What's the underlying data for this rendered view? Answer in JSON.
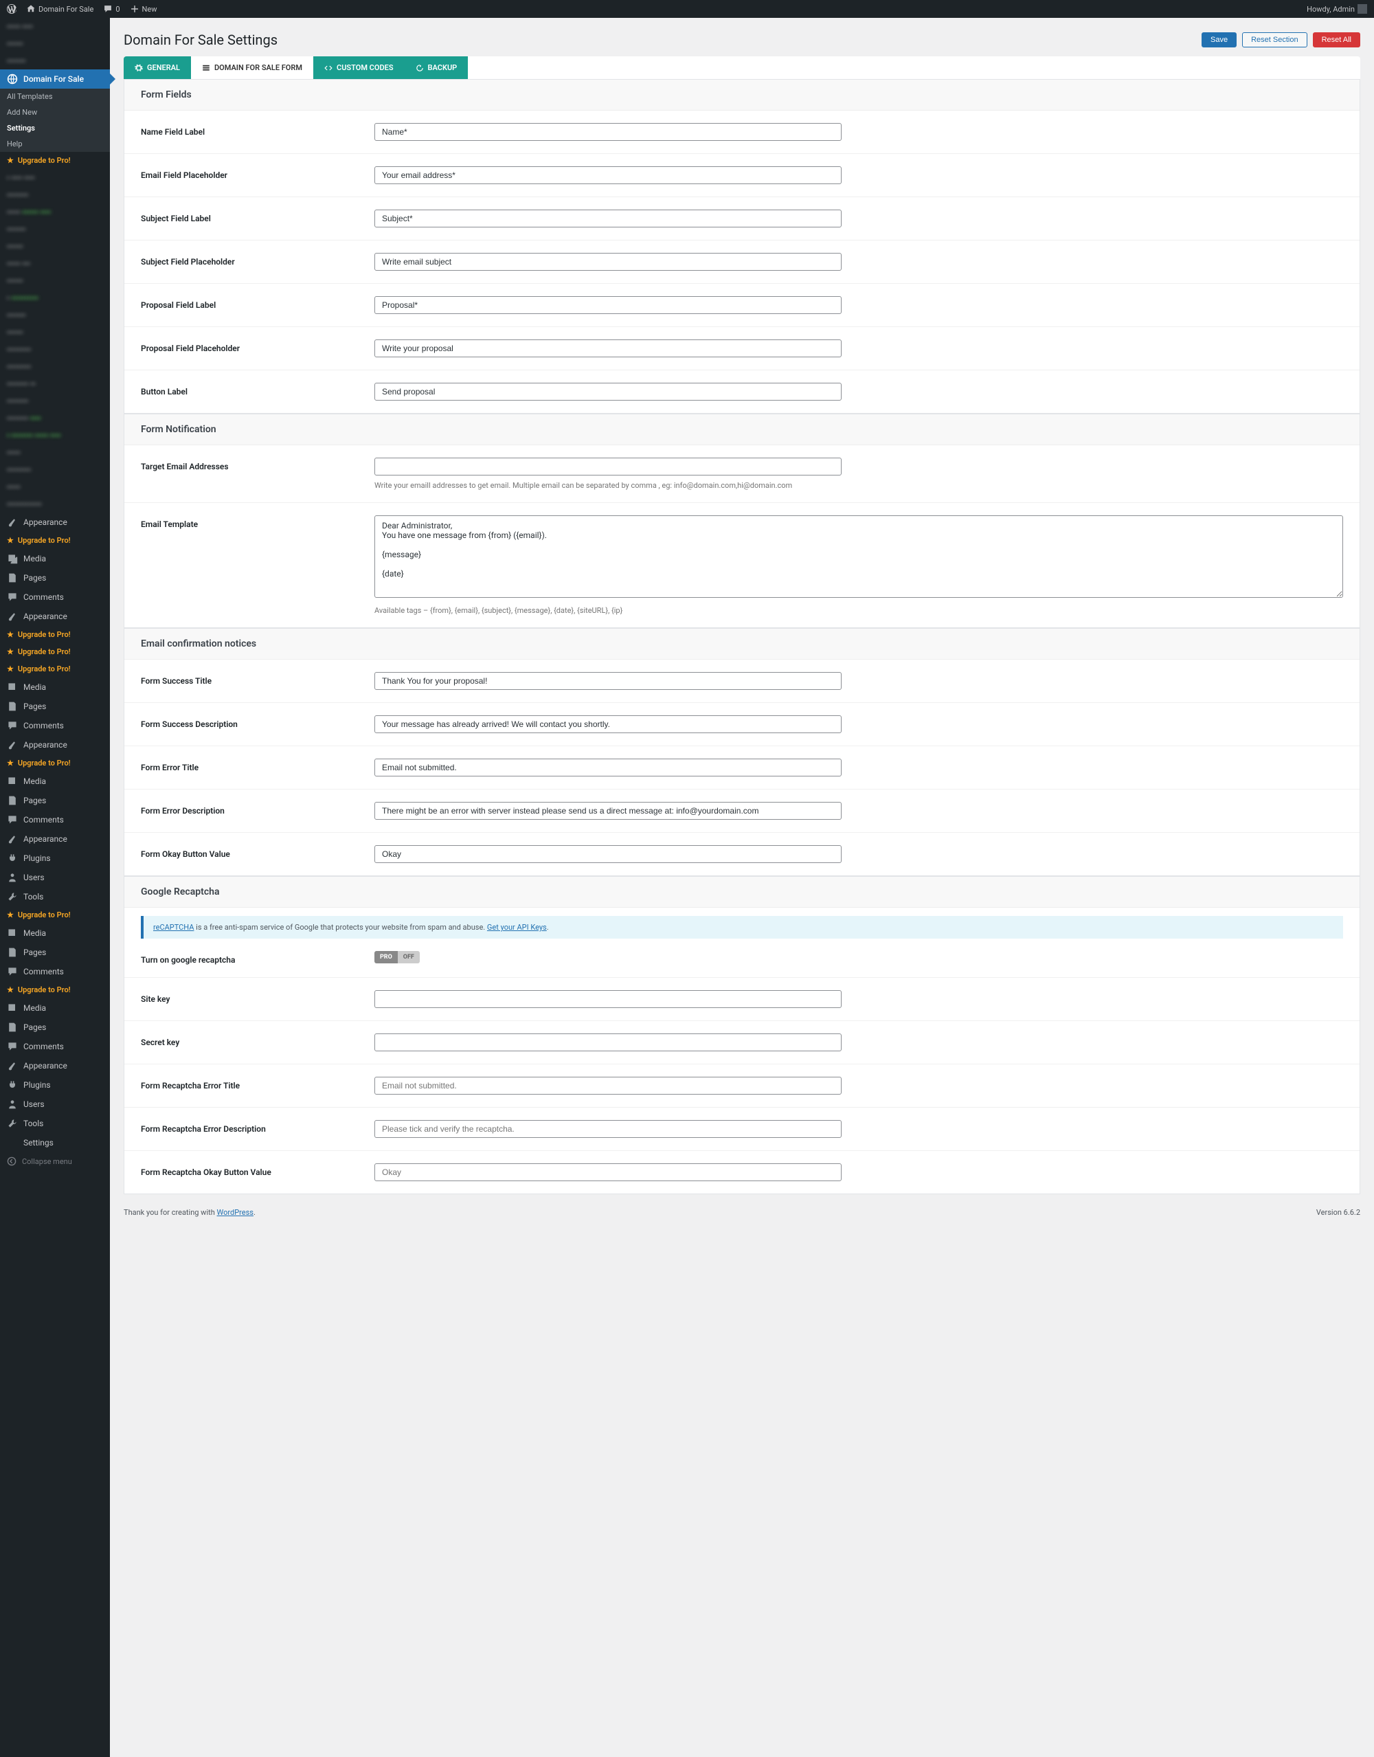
{
  "adminBar": {
    "siteName": "Domain For Sale",
    "comments": "0",
    "newLabel": "New",
    "howdy": "Howdy, Admin"
  },
  "sidebar": {
    "currentPlugin": "Domain For Sale",
    "sub": {
      "allTemplates": "All Templates",
      "addNew": "Add New",
      "settings": "Settings",
      "help": "Help"
    },
    "upgrade": "Upgrade to Pro!",
    "menu": {
      "media": "Media",
      "pages": "Pages",
      "comments": "Comments",
      "appearance": "Appearance",
      "plugins": "Plugins",
      "users": "Users",
      "tools": "Tools",
      "settings": "Settings",
      "collapse": "Collapse menu"
    }
  },
  "page": {
    "title": "Domain For Sale Settings",
    "save": "Save",
    "resetSection": "Reset Section",
    "resetAll": "Reset All"
  },
  "tabs": {
    "general": "GENERAL",
    "form": "DOMAIN FOR SALE FORM",
    "custom": "CUSTOM CODES",
    "backup": "BACKUP"
  },
  "sections": {
    "formFields": {
      "title": "Form Fields",
      "nameLabel": "Name Field Label",
      "nameValue": "Name*",
      "emailPhLabel": "Email Field Placeholder",
      "emailPhValue": "Your email address*",
      "subjLabel": "Subject Field Label",
      "subjValue": "Subject*",
      "subjPhLabel": "Subject Field Placeholder",
      "subjPhValue": "Write email subject",
      "propLabel": "Proposal Field Label",
      "propValue": "Proposal*",
      "propPhLabel": "Proposal Field Placeholder",
      "propPhValue": "Write your proposal",
      "btnLabel": "Button Label",
      "btnValue": "Send proposal"
    },
    "notification": {
      "title": "Form Notification",
      "targetLabel": "Target Email Addresses",
      "targetDesc": "Write your emaill addresses to get email. Multiple email can be separated by comma , eg: info@domain.com,hi@domain.com",
      "templateLabel": "Email Template",
      "templateValue": "Dear Administrator,\nYou have one message from {from} ({email}).\n\n{message}\n\n{date}",
      "templateDesc": "Available tags – {from}, {email}, {subject}, {message}, {date}, {siteURL}, {ip}"
    },
    "confirmation": {
      "title": "Email confirmation notices",
      "successTitleLabel": "Form Success Title",
      "successTitleValue": "Thank You for your proposal!",
      "successDescLabel": "Form Success Description",
      "successDescValue": "Your message has already arrived! We will contact you shortly.",
      "errorTitleLabel": "Form Error Title",
      "errorTitleValue": "Email not submitted.",
      "errorDescLabel": "Form Error Description",
      "errorDescValue": "There might be an error with server instead please send us a direct message at: info@yourdomain.com",
      "okayLabel": "Form Okay Button Value",
      "okayValue": "Okay"
    },
    "recaptcha": {
      "title": "Google Recaptcha",
      "infoLink1": "reCAPTCHA",
      "infoText": " is a free anti-spam service of Google that protects your website from spam and abuse. ",
      "infoLink2": "Get your API Keys",
      "turnOnLabel": "Turn on google recaptcha",
      "togglePro": "PRO",
      "toggleOff": "OFF",
      "siteKeyLabel": "Site key",
      "secretKeyLabel": "Secret key",
      "errTitleLabel": "Form Recaptcha Error Title",
      "errTitlePh": "Email not submitted.",
      "errDescLabel": "Form Recaptcha Error Description",
      "errDescPh": "Please tick and verify the recaptcha.",
      "okayLabel": "Form Recaptcha Okay Button Value",
      "okayPh": "Okay"
    }
  },
  "footer": {
    "thank": "Thank you for creating with ",
    "wp": "WordPress",
    "version": "Version 6.6.2"
  }
}
